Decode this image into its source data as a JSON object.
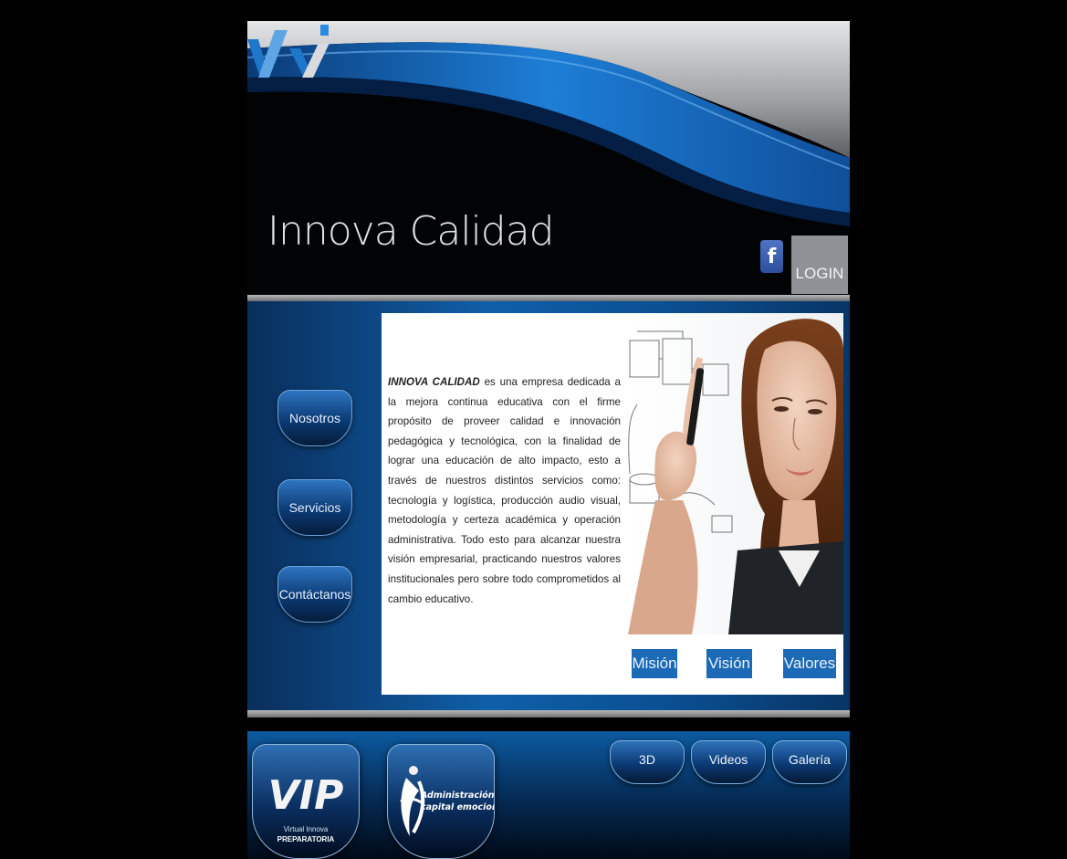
{
  "brand": {
    "name": "Innova Calidad"
  },
  "header": {
    "facebook_label": "f",
    "login_label": "LOGIN"
  },
  "nav": {
    "items": [
      {
        "label": "Nosotros"
      },
      {
        "label": "Servicios"
      },
      {
        "label": "Contáctanos"
      }
    ]
  },
  "intro": {
    "company": "INNOVA CALIDAD",
    "text": " es una empresa dedicada a la mejora continua educativa con el firme propósito de proveer calidad e innovación pedagógica y tecnológica, con la finalidad de lograr una educación de alto impacto, esto a través de nuestros distintos servicios como: tecnología y logística, producción audio visual, metodología y certeza académica y operación administrativa. Todo esto para alcanzar nuestra visión empresarial, practicando nuestros valores institucionales pero sobre todo comprometidos al cambio educativo."
  },
  "pills": [
    {
      "label": "Misión"
    },
    {
      "label": "Visión"
    },
    {
      "label": "Valores"
    }
  ],
  "footer": {
    "promo_vip": {
      "logo": "VIP",
      "line1": "Virtual Innova",
      "line2": "PREPARATORIA"
    },
    "promo_admin": {
      "line1": "Administración de",
      "line2": "capital emocional"
    },
    "media": [
      {
        "label": "3D"
      },
      {
        "label": "Videos"
      },
      {
        "label": "Galería"
      }
    ]
  },
  "colors": {
    "accent_blue": "#1c69b5",
    "dark_blue": "#0a2e5c",
    "facebook_blue": "#3b5998",
    "login_gray": "#8f9196"
  }
}
